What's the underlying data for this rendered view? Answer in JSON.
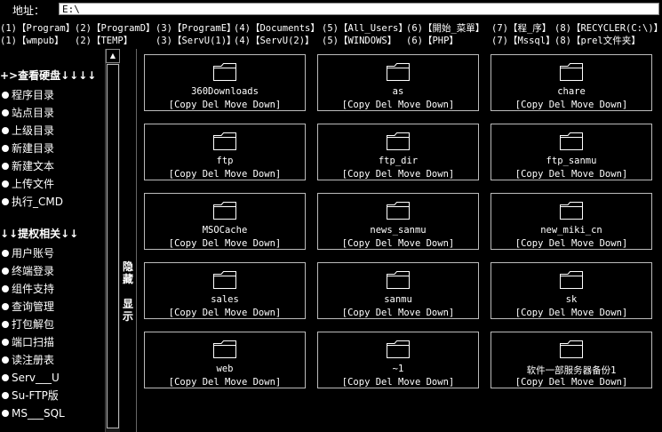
{
  "address": {
    "label": "地址：",
    "value": "E:\\"
  },
  "drives_row1": [
    "(1)【Program】",
    "(2)【ProgramD】",
    "(3)【ProgramE】",
    "(4)【Documents】",
    "(5)【All_Users】",
    "(6)【開始_菜單】",
    "(7)【程_序】",
    "(8)【RECYCLER(C:\\)】"
  ],
  "drives_row2": [
    "(1)【wmpub】",
    "(2)【TEMP】",
    "(3)【ServU(1)】",
    "(4)【ServU(2)】",
    "(5)【WINDOWS】",
    "(6)【PHP】",
    "(7)【Mssql】",
    "(8)【prel文件夹】"
  ],
  "sidebar": {
    "section1_title": "+>查看硬盘↓↓↓↓",
    "section1_items": [
      "程序目录",
      "站点目录",
      "上级目录",
      "新建目录",
      "新建文本",
      "上传文件",
      "执行_CMD"
    ],
    "section2_title": "↓↓提权相关↓↓",
    "section2_items": [
      "用户账号",
      "终端登录",
      "组件支持",
      "查询管理",
      "打包解包",
      "端口扫描",
      "读注册表",
      "Serv___U",
      "Su-FTP版",
      "MS___SQL"
    ]
  },
  "toggle": {
    "chars": [
      "隐",
      "藏",
      "",
      "显",
      "示"
    ]
  },
  "folders": [
    "360Downloads",
    "as",
    "chare",
    "ftp",
    "ftp_dir",
    "ftp_sanmu",
    "MSOCache",
    "news_sanmu",
    "new_miki_cn",
    "sales",
    "sanmu",
    "sk",
    "web",
    "~1",
    "软件一部服务器备份1"
  ],
  "folder_actions": "[Copy Del Move Down]",
  "icons": {
    "folder": "folder-icon",
    "scroll_up": "triangle-up-icon",
    "bullet": "bullet-dot-icon"
  }
}
